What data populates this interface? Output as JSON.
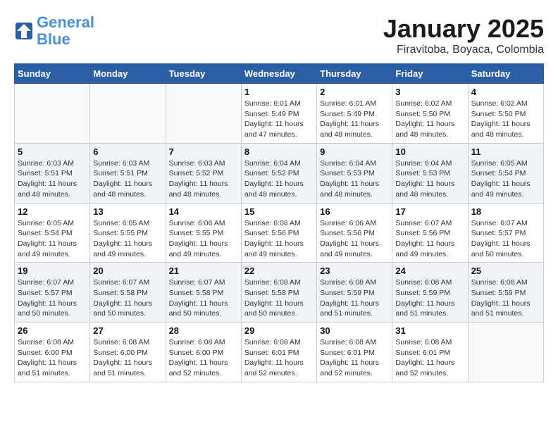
{
  "header": {
    "logo_line1": "General",
    "logo_line2": "Blue",
    "month": "January 2025",
    "location": "Firavitoba, Boyaca, Colombia"
  },
  "days_of_week": [
    "Sunday",
    "Monday",
    "Tuesday",
    "Wednesday",
    "Thursday",
    "Friday",
    "Saturday"
  ],
  "weeks": [
    [
      {
        "day": "",
        "info": ""
      },
      {
        "day": "",
        "info": ""
      },
      {
        "day": "",
        "info": ""
      },
      {
        "day": "1",
        "info": "Sunrise: 6:01 AM\nSunset: 5:49 PM\nDaylight: 11 hours\nand 47 minutes."
      },
      {
        "day": "2",
        "info": "Sunrise: 6:01 AM\nSunset: 5:49 PM\nDaylight: 11 hours\nand 48 minutes."
      },
      {
        "day": "3",
        "info": "Sunrise: 6:02 AM\nSunset: 5:50 PM\nDaylight: 11 hours\nand 48 minutes."
      },
      {
        "day": "4",
        "info": "Sunrise: 6:02 AM\nSunset: 5:50 PM\nDaylight: 11 hours\nand 48 minutes."
      }
    ],
    [
      {
        "day": "5",
        "info": "Sunrise: 6:03 AM\nSunset: 5:51 PM\nDaylight: 11 hours\nand 48 minutes."
      },
      {
        "day": "6",
        "info": "Sunrise: 6:03 AM\nSunset: 5:51 PM\nDaylight: 11 hours\nand 48 minutes."
      },
      {
        "day": "7",
        "info": "Sunrise: 6:03 AM\nSunset: 5:52 PM\nDaylight: 11 hours\nand 48 minutes."
      },
      {
        "day": "8",
        "info": "Sunrise: 6:04 AM\nSunset: 5:52 PM\nDaylight: 11 hours\nand 48 minutes."
      },
      {
        "day": "9",
        "info": "Sunrise: 6:04 AM\nSunset: 5:53 PM\nDaylight: 11 hours\nand 48 minutes."
      },
      {
        "day": "10",
        "info": "Sunrise: 6:04 AM\nSunset: 5:53 PM\nDaylight: 11 hours\nand 48 minutes."
      },
      {
        "day": "11",
        "info": "Sunrise: 6:05 AM\nSunset: 5:54 PM\nDaylight: 11 hours\nand 49 minutes."
      }
    ],
    [
      {
        "day": "12",
        "info": "Sunrise: 6:05 AM\nSunset: 5:54 PM\nDaylight: 11 hours\nand 49 minutes."
      },
      {
        "day": "13",
        "info": "Sunrise: 6:05 AM\nSunset: 5:55 PM\nDaylight: 11 hours\nand 49 minutes."
      },
      {
        "day": "14",
        "info": "Sunrise: 6:06 AM\nSunset: 5:55 PM\nDaylight: 11 hours\nand 49 minutes."
      },
      {
        "day": "15",
        "info": "Sunrise: 6:06 AM\nSunset: 5:56 PM\nDaylight: 11 hours\nand 49 minutes."
      },
      {
        "day": "16",
        "info": "Sunrise: 6:06 AM\nSunset: 5:56 PM\nDaylight: 11 hours\nand 49 minutes."
      },
      {
        "day": "17",
        "info": "Sunrise: 6:07 AM\nSunset: 5:56 PM\nDaylight: 11 hours\nand 49 minutes."
      },
      {
        "day": "18",
        "info": "Sunrise: 6:07 AM\nSunset: 5:57 PM\nDaylight: 11 hours\nand 50 minutes."
      }
    ],
    [
      {
        "day": "19",
        "info": "Sunrise: 6:07 AM\nSunset: 5:57 PM\nDaylight: 11 hours\nand 50 minutes."
      },
      {
        "day": "20",
        "info": "Sunrise: 6:07 AM\nSunset: 5:58 PM\nDaylight: 11 hours\nand 50 minutes."
      },
      {
        "day": "21",
        "info": "Sunrise: 6:07 AM\nSunset: 5:58 PM\nDaylight: 11 hours\nand 50 minutes."
      },
      {
        "day": "22",
        "info": "Sunrise: 6:08 AM\nSunset: 5:58 PM\nDaylight: 11 hours\nand 50 minutes."
      },
      {
        "day": "23",
        "info": "Sunrise: 6:08 AM\nSunset: 5:59 PM\nDaylight: 11 hours\nand 51 minutes."
      },
      {
        "day": "24",
        "info": "Sunrise: 6:08 AM\nSunset: 5:59 PM\nDaylight: 11 hours\nand 51 minutes."
      },
      {
        "day": "25",
        "info": "Sunrise: 6:08 AM\nSunset: 5:59 PM\nDaylight: 11 hours\nand 51 minutes."
      }
    ],
    [
      {
        "day": "26",
        "info": "Sunrise: 6:08 AM\nSunset: 6:00 PM\nDaylight: 11 hours\nand 51 minutes."
      },
      {
        "day": "27",
        "info": "Sunrise: 6:08 AM\nSunset: 6:00 PM\nDaylight: 11 hours\nand 51 minutes."
      },
      {
        "day": "28",
        "info": "Sunrise: 6:08 AM\nSunset: 6:00 PM\nDaylight: 11 hours\nand 52 minutes."
      },
      {
        "day": "29",
        "info": "Sunrise: 6:08 AM\nSunset: 6:01 PM\nDaylight: 11 hours\nand 52 minutes."
      },
      {
        "day": "30",
        "info": "Sunrise: 6:08 AM\nSunset: 6:01 PM\nDaylight: 11 hours\nand 52 minutes."
      },
      {
        "day": "31",
        "info": "Sunrise: 6:08 AM\nSunset: 6:01 PM\nDaylight: 11 hours\nand 52 minutes."
      },
      {
        "day": "",
        "info": ""
      }
    ]
  ]
}
